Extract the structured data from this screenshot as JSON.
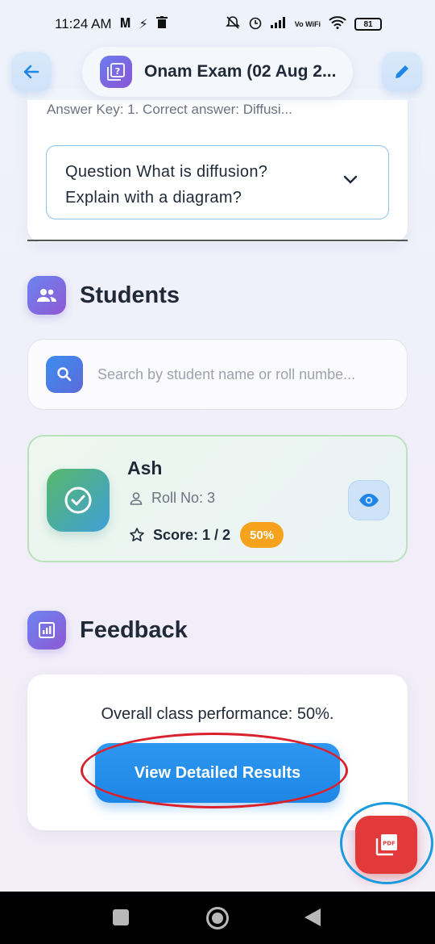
{
  "status_bar": {
    "time": "11:24 AM",
    "battery": "81",
    "network_label": "Vo WiFi"
  },
  "header": {
    "title": "Onam Exam (02 Aug 2..."
  },
  "question_card": {
    "answer_key": "Answer Key: 1. Correct answer: Diffusi...",
    "question_line1": "Question What is diffusion?",
    "question_line2": "Explain with a diagram?"
  },
  "students": {
    "title": "Students",
    "search_placeholder": "Search by student name or roll numbe...",
    "items": [
      {
        "name": "Ash",
        "roll": "Roll No: 3",
        "score": "Score: 1 / 2",
        "percent": "50%"
      }
    ]
  },
  "feedback": {
    "title": "Feedback",
    "summary": "Overall class performance: 50%.",
    "button_label": "View Detailed Results"
  },
  "fab": {
    "label": "PDF"
  },
  "colors": {
    "accent_blue": "#1e86e6",
    "success_green": "#58b86a",
    "badge_orange": "#f6a21c",
    "pdf_red": "#e23a3a",
    "annotation_red": "#d9212e",
    "annotation_blue": "#1a9be0"
  }
}
